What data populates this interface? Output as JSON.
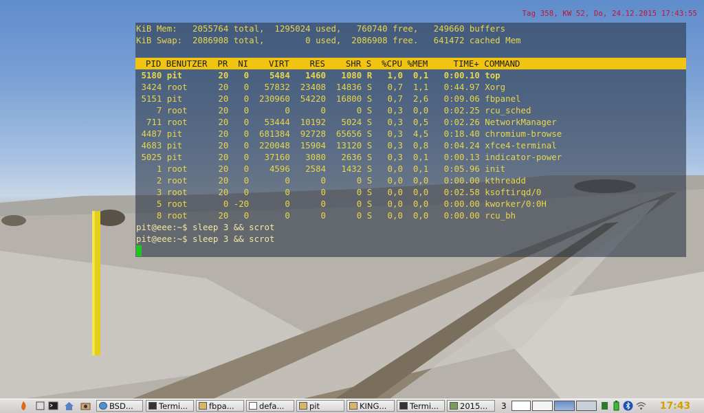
{
  "desktop": {
    "clock_text": "Tag 358, KW 52, Do, 24.12.2015  17:43:55"
  },
  "terminal": {
    "lines": [
      "KiB Mem:   2055764 total,  1295024 used,   760740 free,   249660 buffers",
      "KiB Swap:  2086908 total,        0 used,  2086908 free.   641472 cached Mem",
      "",
      "  PID BENUTZER  PR  NI    VIRT    RES    SHR S  %CPU %MEM     TIME+ COMMAND",
      " 5180 pit       20   0    5484   1460   1080 R   1,0  0,1   0:00.10 top",
      " 3424 root      20   0   57832  23408  14836 S   0,7  1,1   0:44.97 Xorg",
      " 5151 pit       20   0  230960  54220  16800 S   0,7  2,6   0:09.06 fbpanel",
      "    7 root      20   0       0      0      0 S   0,3  0,0   0:02.25 rcu_sched",
      "  711 root      20   0   53444  10192   5024 S   0,3  0,5   0:02.26 NetworkManager",
      " 4487 pit       20   0  681384  92728  65656 S   0,3  4,5   0:18.40 chromium-browse",
      " 4683 pit       20   0  220048  15904  13120 S   0,3  0,8   0:04.24 xfce4-terminal",
      " 5025 pit       20   0   37160   3080   2636 S   0,3  0,1   0:00.13 indicator-power",
      "    1 root      20   0    4596   2584   1432 S   0,0  0,1   0:05.96 init",
      "    2 root      20   0       0      0      0 S   0,0  0,0   0:00.00 kthreadd",
      "    3 root      20   0       0      0      0 S   0,0  0,0   0:02.58 ksoftirqd/0",
      "    5 root       0 -20       0      0      0 S   0,0  0,0   0:00.00 kworker/0:0H",
      "    8 root      20   0       0      0      0 S   0,0  0,0   0:00.00 rcu_bh",
      "pit@eee:~$ sleep 3 && scrot",
      "pit@eee:~$ sleep 3 && scrot"
    ]
  },
  "taskbar": {
    "tasks": [
      {
        "label": "BSD..."
      },
      {
        "label": "Termi..."
      },
      {
        "label": "fbpa..."
      },
      {
        "label": "defa..."
      },
      {
        "label": "pit"
      },
      {
        "label": "KING..."
      },
      {
        "label": "Termi..."
      },
      {
        "label": "2015..."
      }
    ],
    "workspace_number": "3",
    "clock": "17:43"
  }
}
